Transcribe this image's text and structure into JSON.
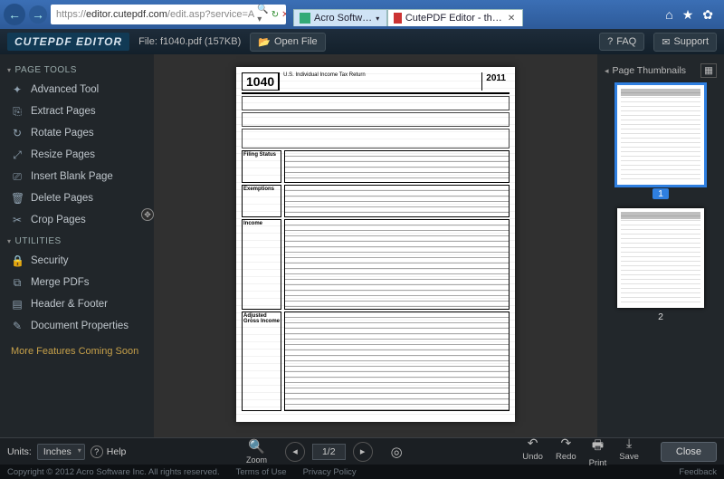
{
  "browser": {
    "url_plain": "https://",
    "url_host": "editor.cutepdf.com",
    "url_path": "/edit.asp?service=A",
    "search_badge": "🔍 ▾",
    "refresh": "↻",
    "stop": "✕",
    "tabs": [
      {
        "label": "Acro Softw…"
      },
      {
        "label": "CutePDF Editor - th…"
      }
    ]
  },
  "header": {
    "logo": "CUTEPDF EDITOR",
    "file_label": "File: f1040.pdf (157KB)",
    "open_file": "Open File",
    "faq": "FAQ",
    "support": "Support"
  },
  "sidebar": {
    "section_page": "PAGE TOOLS",
    "page_items": [
      {
        "icon": "✦",
        "label": "Advanced Tool"
      },
      {
        "icon": "⎘",
        "label": "Extract Pages"
      },
      {
        "icon": "↻",
        "label": "Rotate Pages"
      },
      {
        "icon": "⤢",
        "label": "Resize Pages"
      },
      {
        "icon": "⎚",
        "label": "Insert Blank Page"
      },
      {
        "icon": "🗑",
        "label": "Delete Pages"
      },
      {
        "icon": "✂",
        "label": "Crop Pages"
      }
    ],
    "section_util": "UTILITIES",
    "util_items": [
      {
        "icon": "🔒",
        "label": "Security"
      },
      {
        "icon": "⧉",
        "label": "Merge PDFs"
      },
      {
        "icon": "▤",
        "label": "Header & Footer"
      },
      {
        "icon": "✎",
        "label": "Document Properties"
      }
    ],
    "coming": "More Features Coming Soon"
  },
  "document": {
    "form_number": "1040",
    "form_title": "U.S. Individual Income Tax Return",
    "form_year": "2011",
    "sections": [
      "Filing Status",
      "Exemptions",
      "Income",
      "Adjusted Gross Income"
    ]
  },
  "thumbs": {
    "title": "Page Thumbnails",
    "pages": [
      "1",
      "2"
    ],
    "selected": 0
  },
  "bottom": {
    "units_label": "Units:",
    "units_value": "Inches",
    "help": "Help",
    "zoom": "Zoom",
    "page_indicator": "1/2",
    "actions": [
      {
        "icon": "↶",
        "label": "Undo"
      },
      {
        "icon": "↷",
        "label": "Redo"
      },
      {
        "icon": "🖶",
        "label": "Print"
      },
      {
        "icon": "⤓",
        "label": "Save"
      }
    ],
    "close": "Close"
  },
  "footer": {
    "copyright": "Copyright © 2012 Acro Software Inc. All rights reserved.",
    "terms": "Terms of Use",
    "privacy": "Privacy Policy",
    "feedback": "Feedback"
  }
}
